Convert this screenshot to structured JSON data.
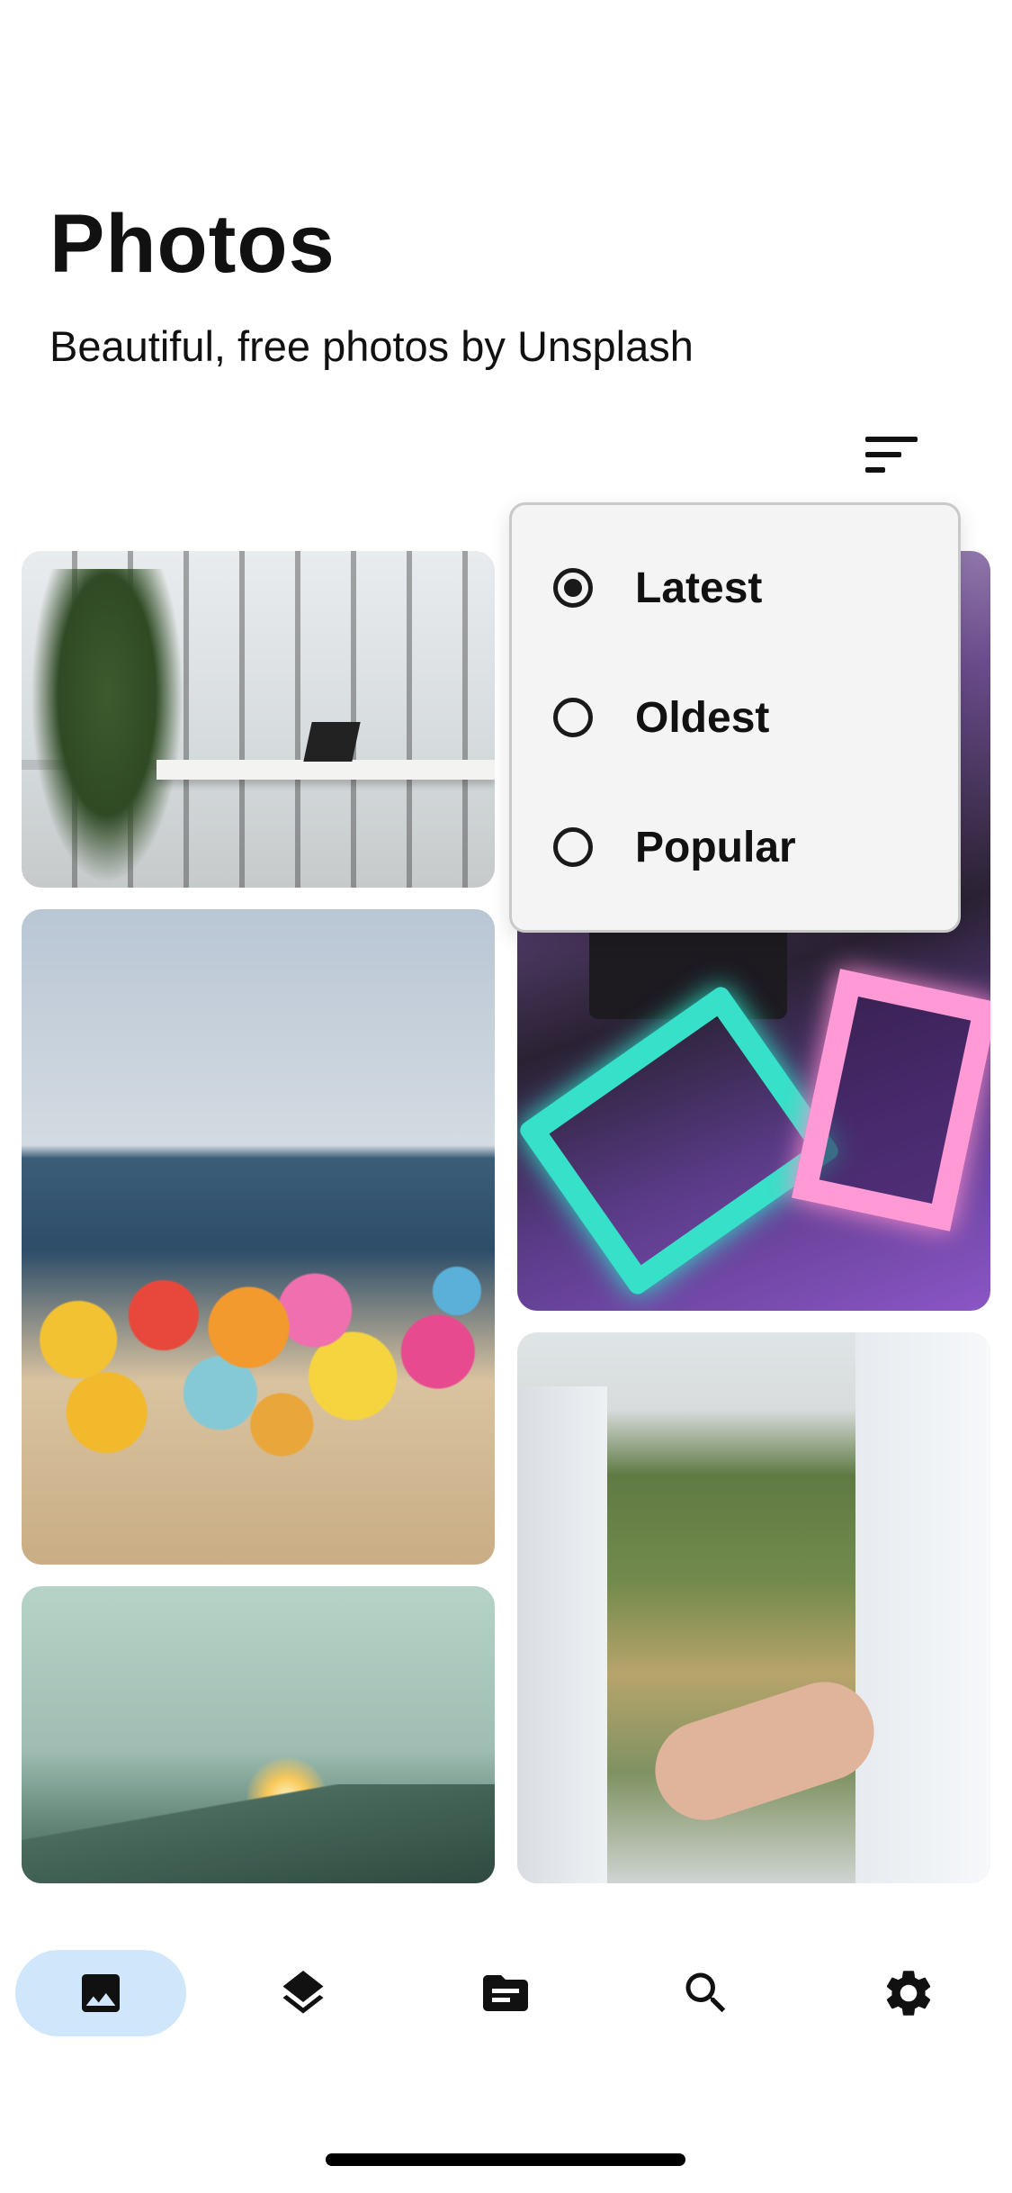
{
  "header": {
    "title": "Photos",
    "subtitle": "Beautiful, free photos by Unsplash"
  },
  "toolbar": {
    "sort_icon": "sort-icon"
  },
  "photos": [
    {
      "name": "photo-office"
    },
    {
      "name": "photo-beach-floats"
    },
    {
      "name": "photo-mountain-balloons"
    },
    {
      "name": "photo-neon-studio"
    },
    {
      "name": "photo-holding-hands"
    }
  ],
  "sort_menu": {
    "items": [
      {
        "label": "Latest",
        "selected": true
      },
      {
        "label": "Oldest",
        "selected": false
      },
      {
        "label": "Popular",
        "selected": false
      }
    ]
  },
  "bottom_nav": {
    "items": [
      {
        "icon": "image-icon",
        "active": true
      },
      {
        "icon": "layers-icon",
        "active": false
      },
      {
        "icon": "folder-icon",
        "active": false
      },
      {
        "icon": "search-icon",
        "active": false
      },
      {
        "icon": "settings-icon",
        "active": false
      }
    ],
    "active_color": "#cfe6fb"
  }
}
